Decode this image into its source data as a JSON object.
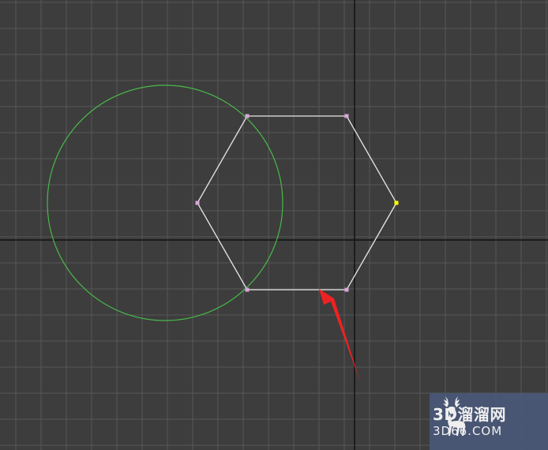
{
  "viewport": {
    "background": "#3d3d3d",
    "grid_color": "#565656",
    "axis_color": "#111111",
    "circle_color": "#49b849",
    "hexagon_color": "#e8e8e8",
    "vertex_color": "#d9a5d9",
    "selected_vertex_color": "#ffff00",
    "arrow_color": "#ee2222",
    "objects": [
      {
        "kind": "circle",
        "icon": "circle-shape"
      },
      {
        "kind": "hexagon",
        "icon": "hexagon-shape",
        "vertex_count": 6,
        "selected_vertex_index": 0
      },
      {
        "kind": "annotation-arrow",
        "icon": "red-arrow-icon"
      }
    ]
  },
  "watermark": {
    "title": "3D溜溜网",
    "url": "3D66.COM",
    "icon": "deer-logo",
    "background": "#4a5878"
  }
}
